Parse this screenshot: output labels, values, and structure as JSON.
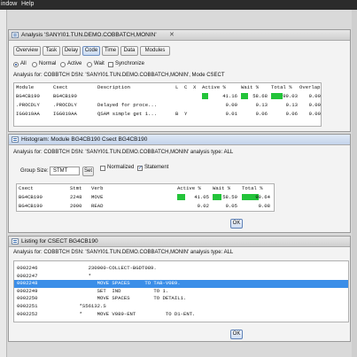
{
  "menubar": {
    "items": [
      "indow",
      "Help"
    ]
  },
  "analysis": {
    "title": "Analysis 'SANYI01.TUN.DEMO.COBBATCH,MONIN'",
    "tabs": [
      "Overview",
      "Task",
      "Delay",
      "Code",
      "Time",
      "Data",
      "Modules"
    ],
    "selected_tab": "Code",
    "filters": {
      "all": "All",
      "normal": "Normal",
      "active": "Active",
      "wait": "Wait",
      "synchronize": "Synchronize"
    },
    "info": "Analysis for: COBBTCH DSN: 'SANYI01.TUN.DEMO.COBBATCH,MONIN', Mode CSECT",
    "columns": [
      "Module",
      "Csect",
      "Description",
      "L",
      "C",
      "X",
      "Active %",
      "Wait %",
      "Total %",
      "Overlap %"
    ],
    "rows": [
      {
        "module": "BG4CB190",
        "csect": "BG4CB190",
        "desc": "",
        "l": "",
        "c": "",
        "x": "",
        "active": "41.16",
        "wait": "58.68",
        "total": "99.03",
        "overlap": "0.00",
        "active_v": 41.16,
        "wait_v": 58.68,
        "total_v": 99.03
      },
      {
        "module": ".PROCDLY",
        "csect": ".PROCDLY",
        "desc": "Delayed for proce...",
        "l": "",
        "c": "",
        "x": "",
        "active": "0.00",
        "wait": "0.13",
        "total": "0.13",
        "overlap": "0.00",
        "active_v": 0,
        "wait_v": 0.13,
        "total_v": 0.13
      },
      {
        "module": "IGG019AA",
        "csect": "IGG019AA",
        "desc": "QSAM simple get 1...",
        "l": "B",
        "c": "Y",
        "x": "",
        "active": "0.01",
        "wait": "0.06",
        "total": "0.06",
        "overlap": "0.00",
        "active_v": 0.01,
        "wait_v": 0.06,
        "total_v": 0.06
      }
    ]
  },
  "histogram": {
    "title": "Histogram: Module BG4CB190 Csect BG4CB190",
    "info": "Analysis for: COBBTCH DSN: 'SANYI01.TUN.DEMO.COBBATCH,MONIN' analysis type: ALL",
    "group_size_label": "Group Size:",
    "group_size_value": "STMT",
    "set_label": "Set",
    "normalized_label": "Normalized",
    "statement_label": "Statement",
    "columns": [
      "Csect",
      "Stmt",
      "Verb",
      "Active %",
      "Wait %",
      "Total %"
    ],
    "rows": [
      {
        "csect": "BG4CB190",
        "stmt": "2248",
        "verb": "MOVE",
        "active": "41.05",
        "wait": "58.59",
        "total": "99.64",
        "active_v": 41.05,
        "wait_v": 58.59,
        "total_v": 99.64
      },
      {
        "csect": "BG4CB190",
        "stmt": "2000",
        "verb": "READ",
        "active": "0.02",
        "wait": "0.05",
        "total": "0.08",
        "active_v": 0.02,
        "wait_v": 0.05,
        "total_v": 0.08
      }
    ],
    "ok_label": "OK"
  },
  "listing": {
    "title": "Listing for CSECT BG4CB190",
    "info": "Analysis for: COBBTCH DSN: 'SANYI01.TUN.DEMO.COBBATCH,MONIN' analysis type: ALL",
    "lines": [
      "0002246                 230000-COLLECT-BGDT089.",
      "0002247                 *",
      "0002248                    MOVE SPACES     TO TAB-V089.",
      "0002249                    SET  IND           TO 1.",
      "0002250                    MOVE SPACES        TO DETAIL1.",
      "0002251              *S56132.S",
      "0002252              *     MOVE V089-ENT          TO D1-ENT."
    ],
    "highlight_index": 2,
    "ok_label": "OK"
  },
  "colors": {
    "bar": "#23c43a",
    "highlight": "#3b8ee8"
  }
}
